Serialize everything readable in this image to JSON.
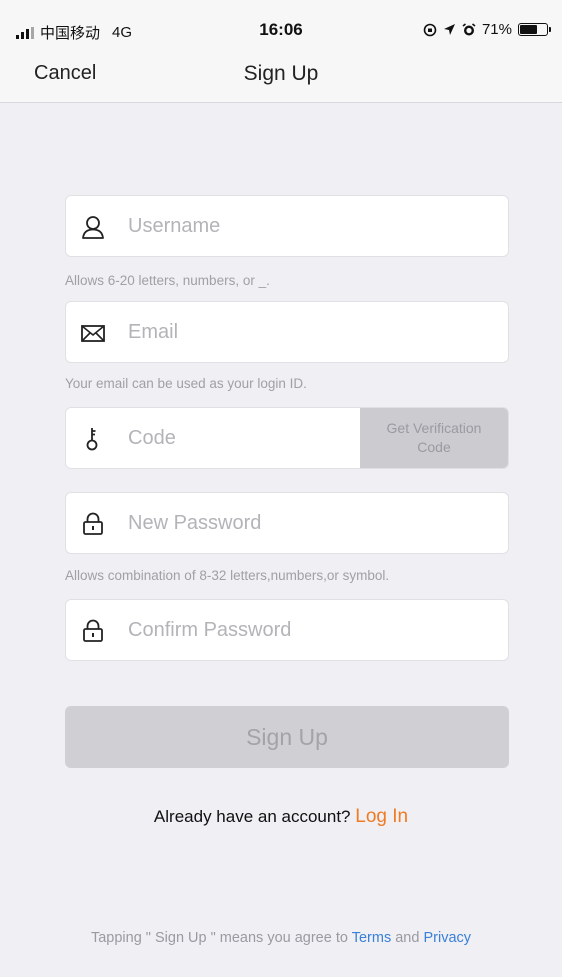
{
  "status_bar": {
    "carrier": "中国移动",
    "network": "4G",
    "time": "16:06",
    "battery": "71%",
    "battery_level": 0.71
  },
  "nav": {
    "cancel_label": "Cancel",
    "title": "Sign Up"
  },
  "form": {
    "username": {
      "placeholder": "Username",
      "value": "",
      "hint": "Allows 6-20 letters, numbers, or _."
    },
    "email": {
      "placeholder": "Email",
      "value": "",
      "hint": "Your email can be used as your login ID."
    },
    "code": {
      "placeholder": "Code",
      "value": "",
      "button_label": "Get Verification Code"
    },
    "new_password": {
      "placeholder": "New Password",
      "value": "",
      "hint": "Allows combination of 8-32 letters,numbers,or symbol."
    },
    "confirm_password": {
      "placeholder": "Confirm Password",
      "value": ""
    },
    "submit_label": "Sign Up"
  },
  "login_prompt": {
    "text": "Already have an account?",
    "link": "Log In"
  },
  "terms": {
    "prefix": "Tapping \" Sign Up \" means you agree to",
    "terms_link": "Terms",
    "conjunction": "and",
    "privacy_link": "Privacy"
  },
  "colors": {
    "accent_orange": "#f07b22",
    "link_blue": "#3b80d6",
    "background": "#efeff4",
    "disabled_button": "#cfcfd4"
  },
  "icons": {
    "username": "user-icon",
    "email": "envelope-icon",
    "code": "key-icon",
    "new_password": "lock-icon",
    "confirm_password": "lock-icon"
  }
}
